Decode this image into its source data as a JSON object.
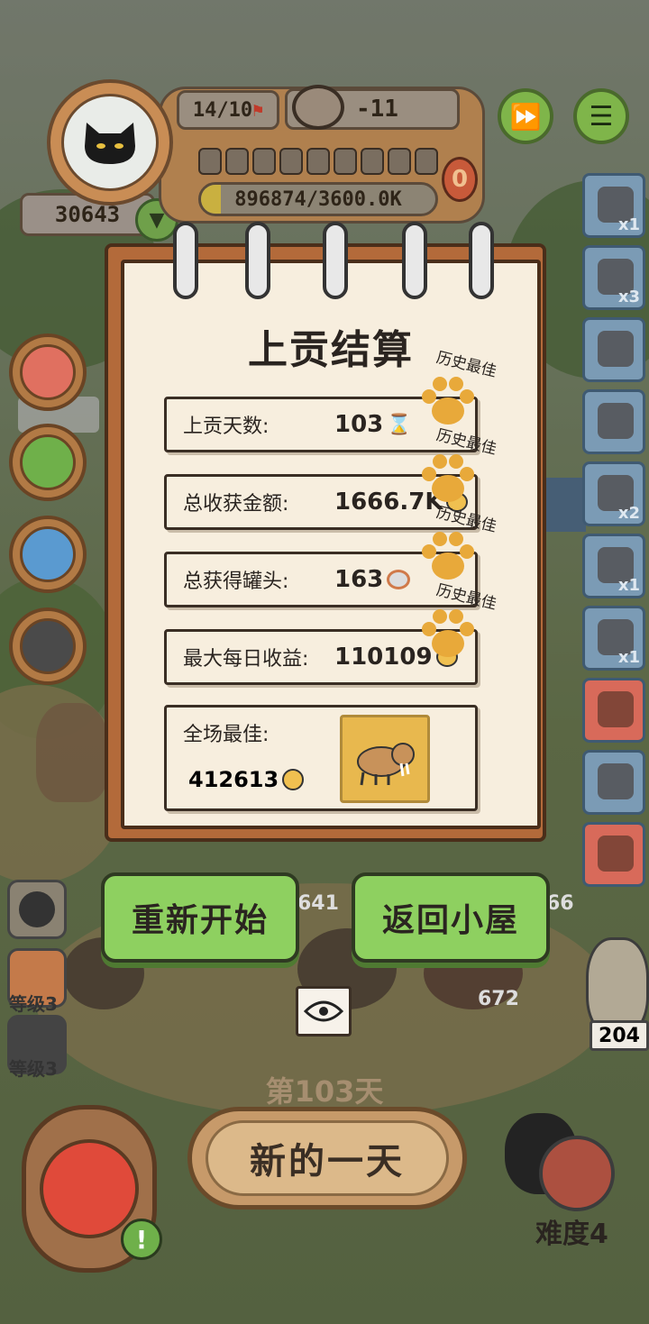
{
  "hud": {
    "population": "14/10",
    "food_delta": "-11",
    "gold_progress": "896874/3600.0K",
    "counter_badge": "0",
    "player_score": "30643"
  },
  "side_items": [
    {
      "icon": "meat-icon",
      "count": "x1"
    },
    {
      "icon": "skull-pile-icon",
      "count": "x3"
    },
    {
      "icon": "crate-icon",
      "count": ""
    },
    {
      "icon": "shrine-icon",
      "count": ""
    },
    {
      "icon": "scythe-icon",
      "count": "x2"
    },
    {
      "icon": "cloth-icon",
      "count": "x1"
    },
    {
      "icon": "shop-icon",
      "count": "x1"
    },
    {
      "icon": "coupon-red-icon",
      "count": ""
    },
    {
      "icon": "coupon-blue-icon",
      "count": ""
    },
    {
      "icon": "hook-icon",
      "count": ""
    }
  ],
  "dialog": {
    "title": "上贡结算",
    "best_label": "历史最佳",
    "rows": [
      {
        "label": "上贡天数:",
        "value": "103",
        "icon": "hourglass-icon"
      },
      {
        "label": "总收获金额:",
        "value": "1666.7K",
        "icon": "coin-icon"
      },
      {
        "label": "总获得罐头:",
        "value": "163",
        "icon": "can-icon"
      },
      {
        "label": "最大每日收益:",
        "value": "110109",
        "icon": "coin-icon"
      }
    ],
    "mvp_label": "全场最佳:",
    "mvp_value": "412613",
    "restart": "重新开始",
    "back_home": "返回小屋"
  },
  "bottom": {
    "day_label": "第103天",
    "new_day": "新的一天",
    "difficulty": "难度4",
    "count_204": "204",
    "count_672": "672",
    "count_641": "641",
    "count_66": "66",
    "level_a": "等级3",
    "level_b": "等级3"
  },
  "colors": {
    "button_green": "#8ed060",
    "paw": "#e8a93a",
    "notebook": "#f7eede"
  }
}
